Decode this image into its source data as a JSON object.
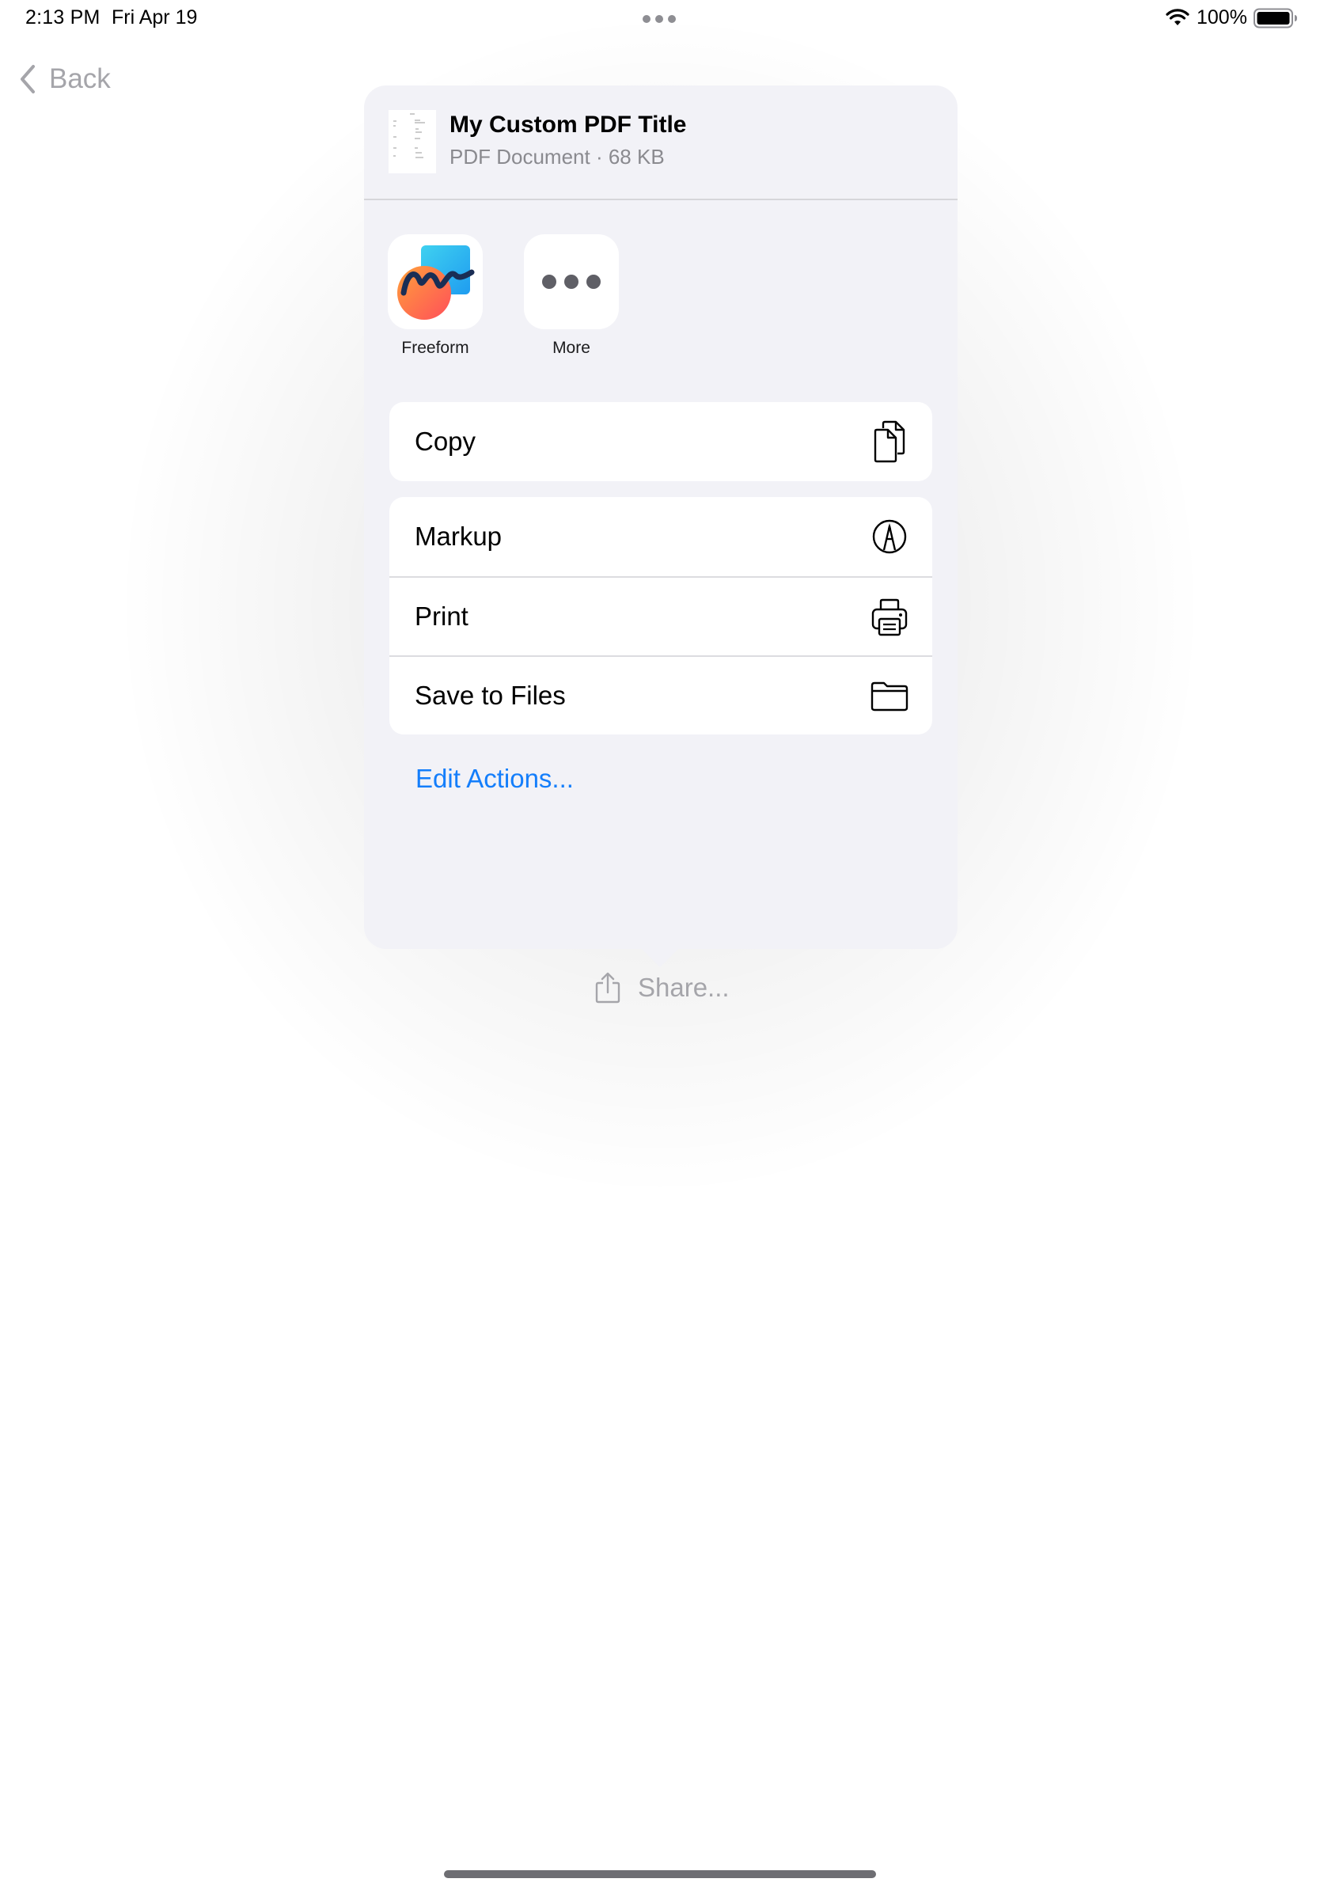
{
  "status_bar": {
    "time": "2:13 PM",
    "date": "Fri Apr 19",
    "battery_percent": "100%",
    "battery_level": 1.0,
    "icons": [
      "wifi-icon",
      "battery-icon",
      "multitasking-dots-icon"
    ]
  },
  "nav": {
    "back_label": "Back",
    "back_icon": "chevron-left-icon"
  },
  "share_sheet": {
    "document": {
      "title": "My Custom PDF Title",
      "subtitle": "PDF Document · 68 KB",
      "thumbnail_icon": "pdf-thumbnail-icon"
    },
    "apps": [
      {
        "label": "Freeform",
        "icon": "freeform-app-icon"
      },
      {
        "label": "More",
        "icon": "more-ellipsis-icon"
      }
    ],
    "action_groups": [
      [
        {
          "label": "Copy",
          "icon": "copy-icon"
        }
      ],
      [
        {
          "label": "Markup",
          "icon": "markup-pen-icon"
        },
        {
          "label": "Print",
          "icon": "printer-icon"
        },
        {
          "label": "Save to Files",
          "icon": "folder-icon"
        }
      ]
    ],
    "edit_actions_label": "Edit Actions..."
  },
  "share_button": {
    "label": "Share...",
    "icon": "share-icon"
  },
  "colors": {
    "sheet_background": "#f2f2f7",
    "link_blue": "#147efb",
    "secondary_text": "#8a8a8f",
    "disabled_gray": "#a5a5aa"
  }
}
